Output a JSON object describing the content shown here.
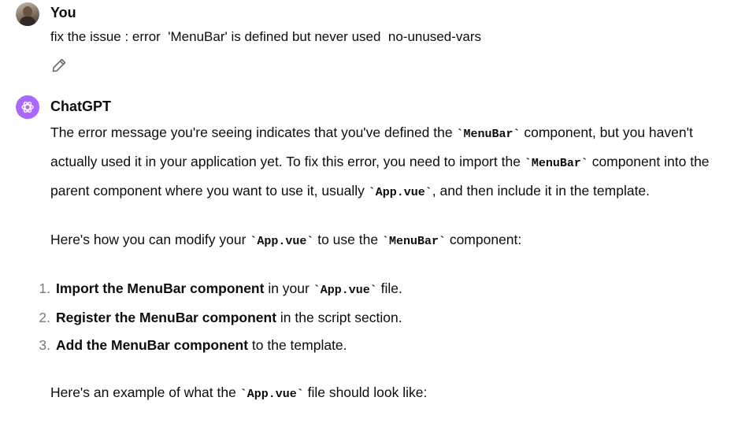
{
  "user_message": {
    "author": "You",
    "text": "fix the issue : error  'MenuBar' is defined but never used  no-unused-vars",
    "edit_icon": "pencil-icon"
  },
  "assistant_message": {
    "author": "ChatGPT",
    "logo_icon": "openai-logo-icon",
    "accent_color": "#ab68ff",
    "p1": {
      "t1": "The error message you're seeing indicates that you've defined the ",
      "c1": "`MenuBar`",
      "t2": " component, but you haven't actually used it in your application yet. To fix this error, you need to import the ",
      "c2": "`MenuBar`",
      "t3": " component into the parent component where you want to use it, usually ",
      "c3": "`App.vue`",
      "t4": ", and then include it in the template."
    },
    "p2": {
      "t1": "Here's how you can modify your ",
      "c1": "`App.vue`",
      "t2": " to use the ",
      "c2": "`MenuBar`",
      "t3": " component:"
    },
    "steps": [
      {
        "num": "1.",
        "bold": "Import the MenuBar component",
        "t1": " in your ",
        "code": "`App.vue`",
        "t2": " file."
      },
      {
        "num": "2.",
        "bold": "Register the MenuBar component",
        "t1": " in the script section."
      },
      {
        "num": "3.",
        "bold": "Add the MenuBar component",
        "t1": " to the template."
      }
    ],
    "p3": {
      "t1": "Here's an example of what the ",
      "c1": "`App.vue`",
      "t2": " file should look like:"
    }
  }
}
